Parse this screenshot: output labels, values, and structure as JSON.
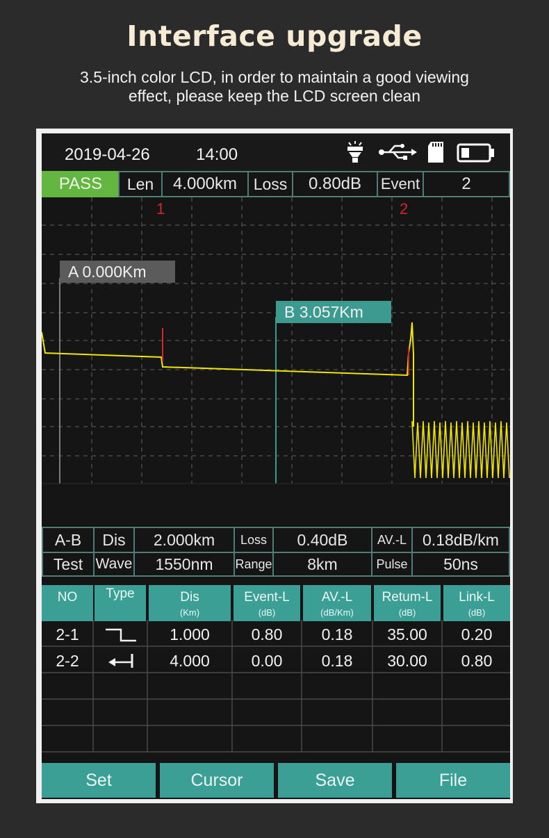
{
  "promo": {
    "title": "Interface upgrade",
    "subtitle_line1": "3.5-inch color LCD, in order to maintain a good viewing",
    "subtitle_line2": "effect, please keep the LCD screen clean"
  },
  "status_bar": {
    "date": "2019-04-26",
    "time": "14:00",
    "icons": [
      "flashlight-icon",
      "usb-icon",
      "sd-card-icon",
      "battery-icon"
    ]
  },
  "summary": {
    "result": "PASS",
    "len_label": "Len",
    "len_value": "4.000km",
    "loss_label": "Loss",
    "loss_value": "0.80dB",
    "event_label": "Event",
    "event_value": "2"
  },
  "trace": {
    "event_labels": [
      "1",
      "2"
    ],
    "cursor_a": "A  0.000Km",
    "cursor_b": "B  3.057Km",
    "trace_color": "#f2e600",
    "event_color": "#d6262b"
  },
  "measurements": {
    "row1": {
      "mode": "A-B",
      "dis_label": "Dis",
      "dis_value": "2.000km",
      "loss_label": "Loss",
      "loss_value": "0.40dB",
      "avl_label": "AV.-L",
      "avl_value": "0.18dB/km"
    },
    "row2": {
      "mode": "Test",
      "wave_label": "Wave",
      "wave_value": "1550nm",
      "range_label": "Range",
      "range_value": "8km",
      "pulse_label": "Pulse",
      "pulse_value": "50ns"
    }
  },
  "event_table": {
    "headers": [
      {
        "label": "NO",
        "unit": ""
      },
      {
        "label": "Type",
        "unit": ""
      },
      {
        "label": "Dis",
        "unit": "(Km)"
      },
      {
        "label": "Event-L",
        "unit": "(dB)"
      },
      {
        "label": "AV.-L",
        "unit": "(dB/Km)"
      },
      {
        "label": "Retum-L",
        "unit": "(dB)"
      },
      {
        "label": "Link-L",
        "unit": "(dB)"
      }
    ],
    "rows": [
      {
        "no": "2-1",
        "type_icon": "step-down-icon",
        "dis": "1.000",
        "event_l": "0.80",
        "av_l": "0.18",
        "return_l": "35.00",
        "link_l": "0.20"
      },
      {
        "no": "2-2",
        "type_icon": "end-arrow-icon",
        "dis": "4.000",
        "event_l": "0.00",
        "av_l": "0.18",
        "return_l": "30.00",
        "link_l": "0.80"
      }
    ]
  },
  "buttons": {
    "set": "Set",
    "cursor": "Cursor",
    "save": "Save",
    "file": "File"
  },
  "colors": {
    "accent_teal": "#3c9f95",
    "pass_green": "#63b63f",
    "background": "#2b2b2b",
    "screen": "#151515"
  }
}
